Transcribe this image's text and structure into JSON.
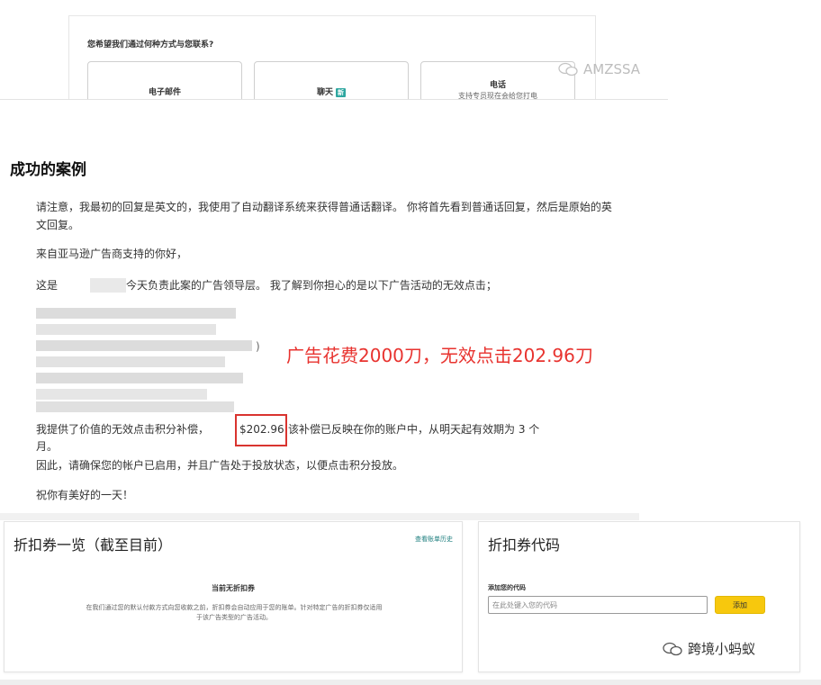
{
  "contact": {
    "question": "您希望我们通过何种方式与您联系?",
    "email_label": "电子邮件",
    "chat_label": "聊天",
    "chat_badge": "新",
    "phone_label": "电话",
    "phone_sub": "支持专员现在会给您打电"
  },
  "watermark_top": "AMZSSA",
  "section_heading": "成功的案例",
  "email": {
    "p1": "请注意，我最初的回复是英文的，我使用了自动翻译系统来获得普通话翻译。 你将首先看到普通话回复，然后是原始的英文回复。",
    "p2": "来自亚马逊广告商支持的你好，",
    "p3_start": "这是",
    "p3_end": "今天负责此案的广告领导层。 我了解到你担心的是以下广告活动的无效点击；",
    "blur_paren": ")",
    "p4_start": "我提供了价值的无效点击积分补偿，",
    "amount": "$202.96",
    "p4_end": "该补偿已反映在你的账户中，从明天起有效期为 3 个",
    "p4_tail": "月。",
    "p5": "因此，请确保您的帐户已启用，并且广告处于投放状态，以便点击积分投放。",
    "p6": "祝你有美好的一天！"
  },
  "annotation": "广告花费2000刀，无效点击202.96刀",
  "coupon_list": {
    "title": "折扣券一览（截至目前）",
    "history_link": "查看账单历史",
    "empty_title": "当前无折扣券",
    "description": "在我们通过您的默认付款方式向您收款之前，折扣券会自动应用于您的账单。针对特定广告的折扣券仅适用于该广告类型的广告活动。"
  },
  "coupon_code": {
    "title": "折扣券代码",
    "input_label": "添加您的代码",
    "input_placeholder": "在此处键入您的代码",
    "add_button": "添加"
  },
  "watermark_bottom": "跨境小蚂蚁",
  "colors": {
    "annotation_red": "#e8332f",
    "highlight_box": "#d9342f",
    "add_button_yellow": "#f7c80d",
    "link_teal": "#1a7c7c"
  }
}
